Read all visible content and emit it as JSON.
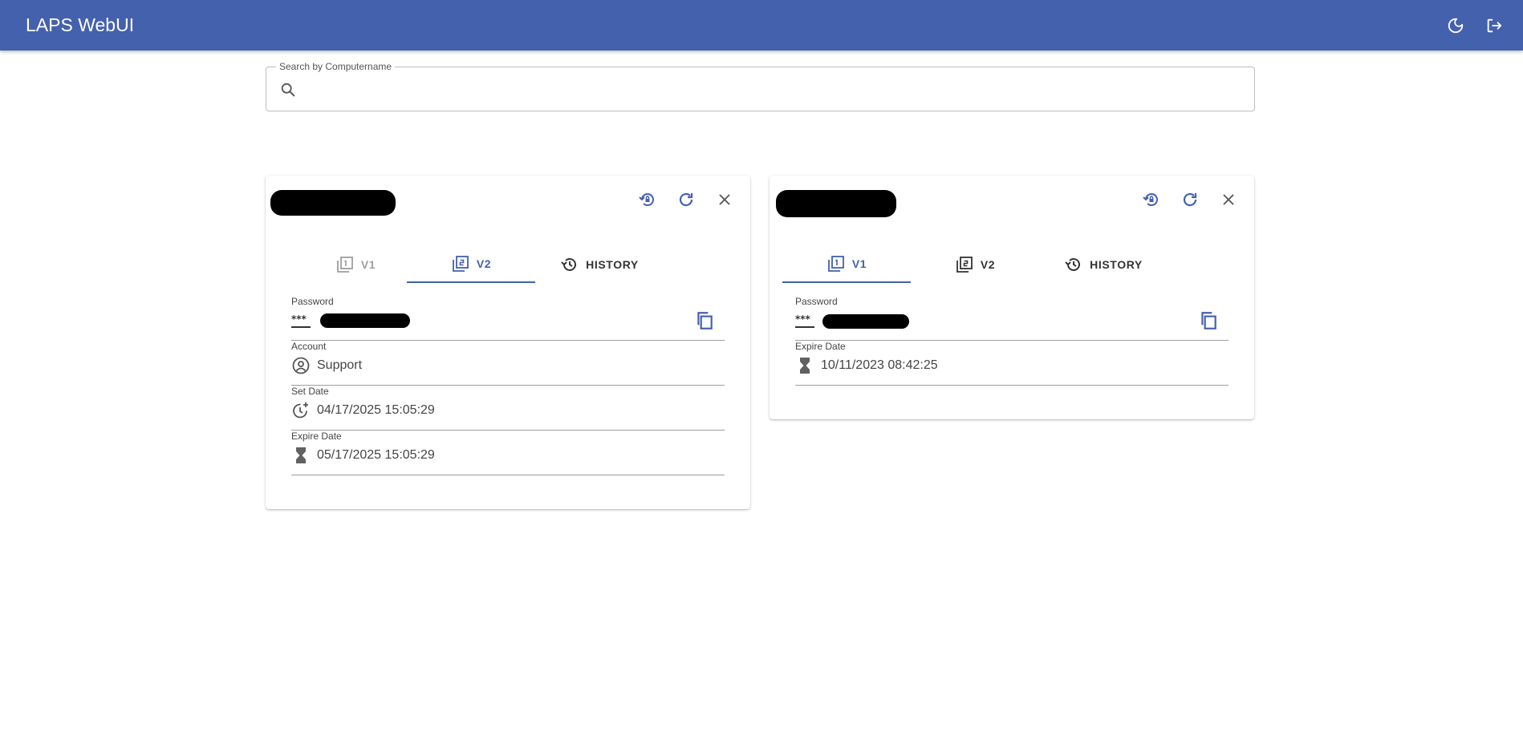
{
  "app": {
    "title": "LAPS WebUI"
  },
  "header": {
    "theme_icon": "moon-icon",
    "logout_icon": "logout-icon"
  },
  "search": {
    "label": "Search by Computername",
    "value": "",
    "icon": "search-icon"
  },
  "colors": {
    "primary": "#4461ae",
    "text": "#444444",
    "divider": "#9e9e9e"
  },
  "cards": [
    {
      "actions": [
        "reset-password-icon",
        "refresh-icon",
        "close-icon"
      ],
      "tabs": [
        {
          "label": "V1",
          "state": "disabled"
        },
        {
          "label": "V2",
          "state": "selected"
        },
        {
          "label": "HISTORY",
          "state": "normal"
        }
      ],
      "fields": [
        {
          "label": "Password",
          "value": "***"
        },
        {
          "label": "Account",
          "value": "Support"
        },
        {
          "label": "Set Date",
          "value": "04/17/2025 15:05:29"
        },
        {
          "label": "Expire Date",
          "value": "05/17/2025 15:05:29"
        }
      ]
    },
    {
      "actions": [
        "reset-password-icon",
        "refresh-icon",
        "close-icon"
      ],
      "tabs": [
        {
          "label": "V1",
          "state": "selected"
        },
        {
          "label": "V2",
          "state": "normal"
        },
        {
          "label": "HISTORY",
          "state": "normal"
        }
      ],
      "fields": [
        {
          "label": "Password",
          "value": "***"
        },
        {
          "label": "Expire Date",
          "value": "10/11/2023 08:42:25"
        }
      ]
    }
  ]
}
